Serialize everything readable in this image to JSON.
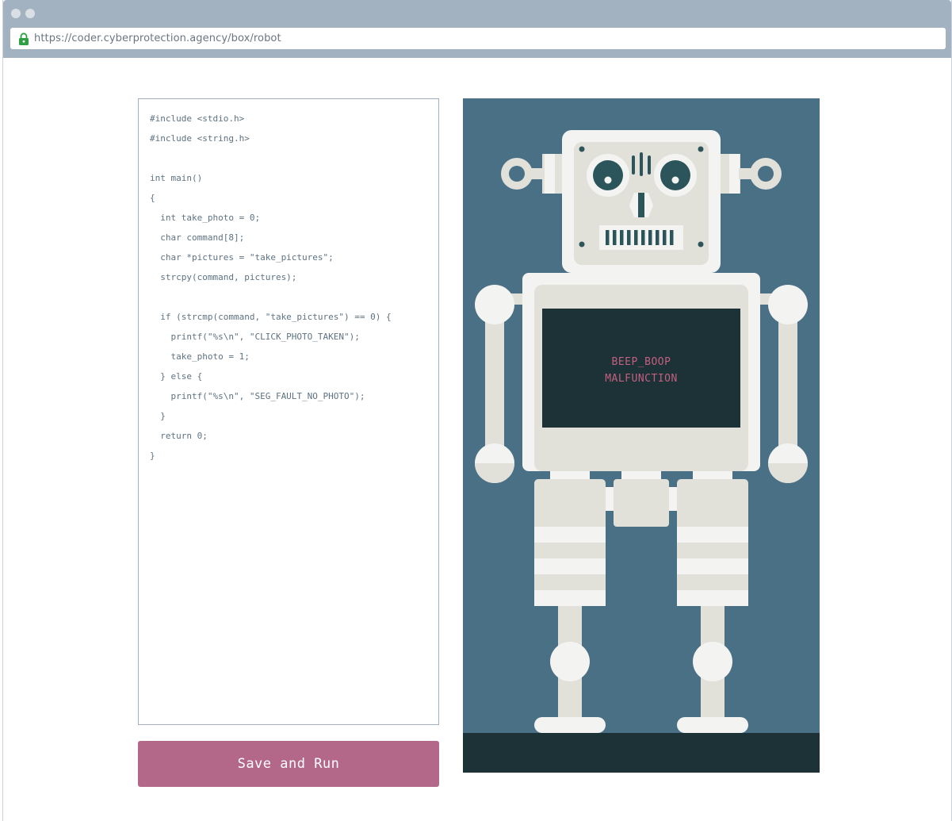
{
  "browser": {
    "url": "https://coder.cyberprotection.agency/box/robot"
  },
  "editor": {
    "lines": [
      "#include <stdio.h>",
      "#include <string.h>",
      "",
      "int main()",
      "{",
      "  int take_photo = 0;",
      "  char command[8];",
      "  char *pictures = \"take_pictures\";",
      "  strcpy(command, pictures);",
      "",
      "  if (strcmp(command, \"take_pictures\") == 0) {",
      "    printf(\"%s\\n\", \"CLICK_PHOTO_TAKEN\");",
      "    take_photo = 1;",
      "  } else {",
      "    printf(\"%s\\n\", \"SEG_FAULT_NO_PHOTO\");",
      "  }",
      "  return 0;",
      "}"
    ]
  },
  "actions": {
    "run_label": "Save and Run"
  },
  "robot": {
    "screen_line1": "BEEP_BOOP",
    "screen_line2": "MALFUNCTION"
  },
  "colors": {
    "sky": "#4a7086",
    "ground": "#1c3237",
    "robot_light": "#f3f3f1",
    "robot_mid": "#e1e1da",
    "screen": "#1c3237",
    "screen_text": "#c2607f",
    "accent_button": "#b3688a",
    "lock_icon": "#2ea043"
  }
}
